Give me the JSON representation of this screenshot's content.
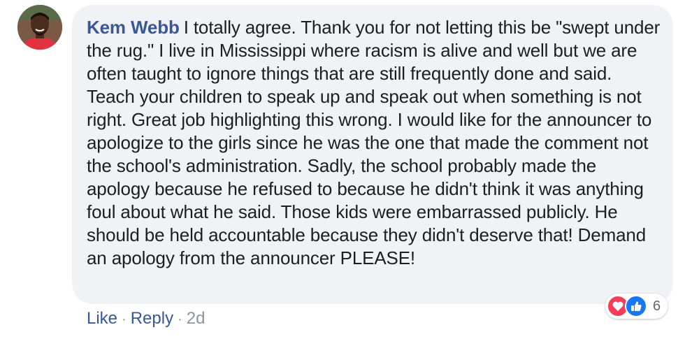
{
  "comment": {
    "author": "Kem Webb",
    "text": "I totally agree. Thank you for not letting this be \"swept under the rug.\" I live in Mississippi where racism is alive and well but we are often taught to ignore things that are still frequently done and said. Teach your children to speak up and speak out when something is not right. Great job highlighting this wrong. I would like for the announcer to apologize to the girls since he was the one that made the comment not the school's administration. Sadly, the school probably made the apology because he refused to because he didn't think it was anything foul about what he said. Those kids were embarrassed publicly. He should be held accountable because they didn't deserve that! Demand an apology from the announcer PLEASE!",
    "reactions": {
      "icons": [
        "heart-icon",
        "like-icon"
      ],
      "count": "6"
    }
  },
  "actions": {
    "like_label": "Like",
    "separator": "·",
    "reply_label": "Reply",
    "time_label": "2d"
  },
  "colors": {
    "author_link": "#385898",
    "bubble_bg": "#f0f2f5",
    "text": "#1c1e21",
    "muted": "#90949c",
    "heart_red": "#f33e58",
    "like_blue": "#1877f2"
  }
}
